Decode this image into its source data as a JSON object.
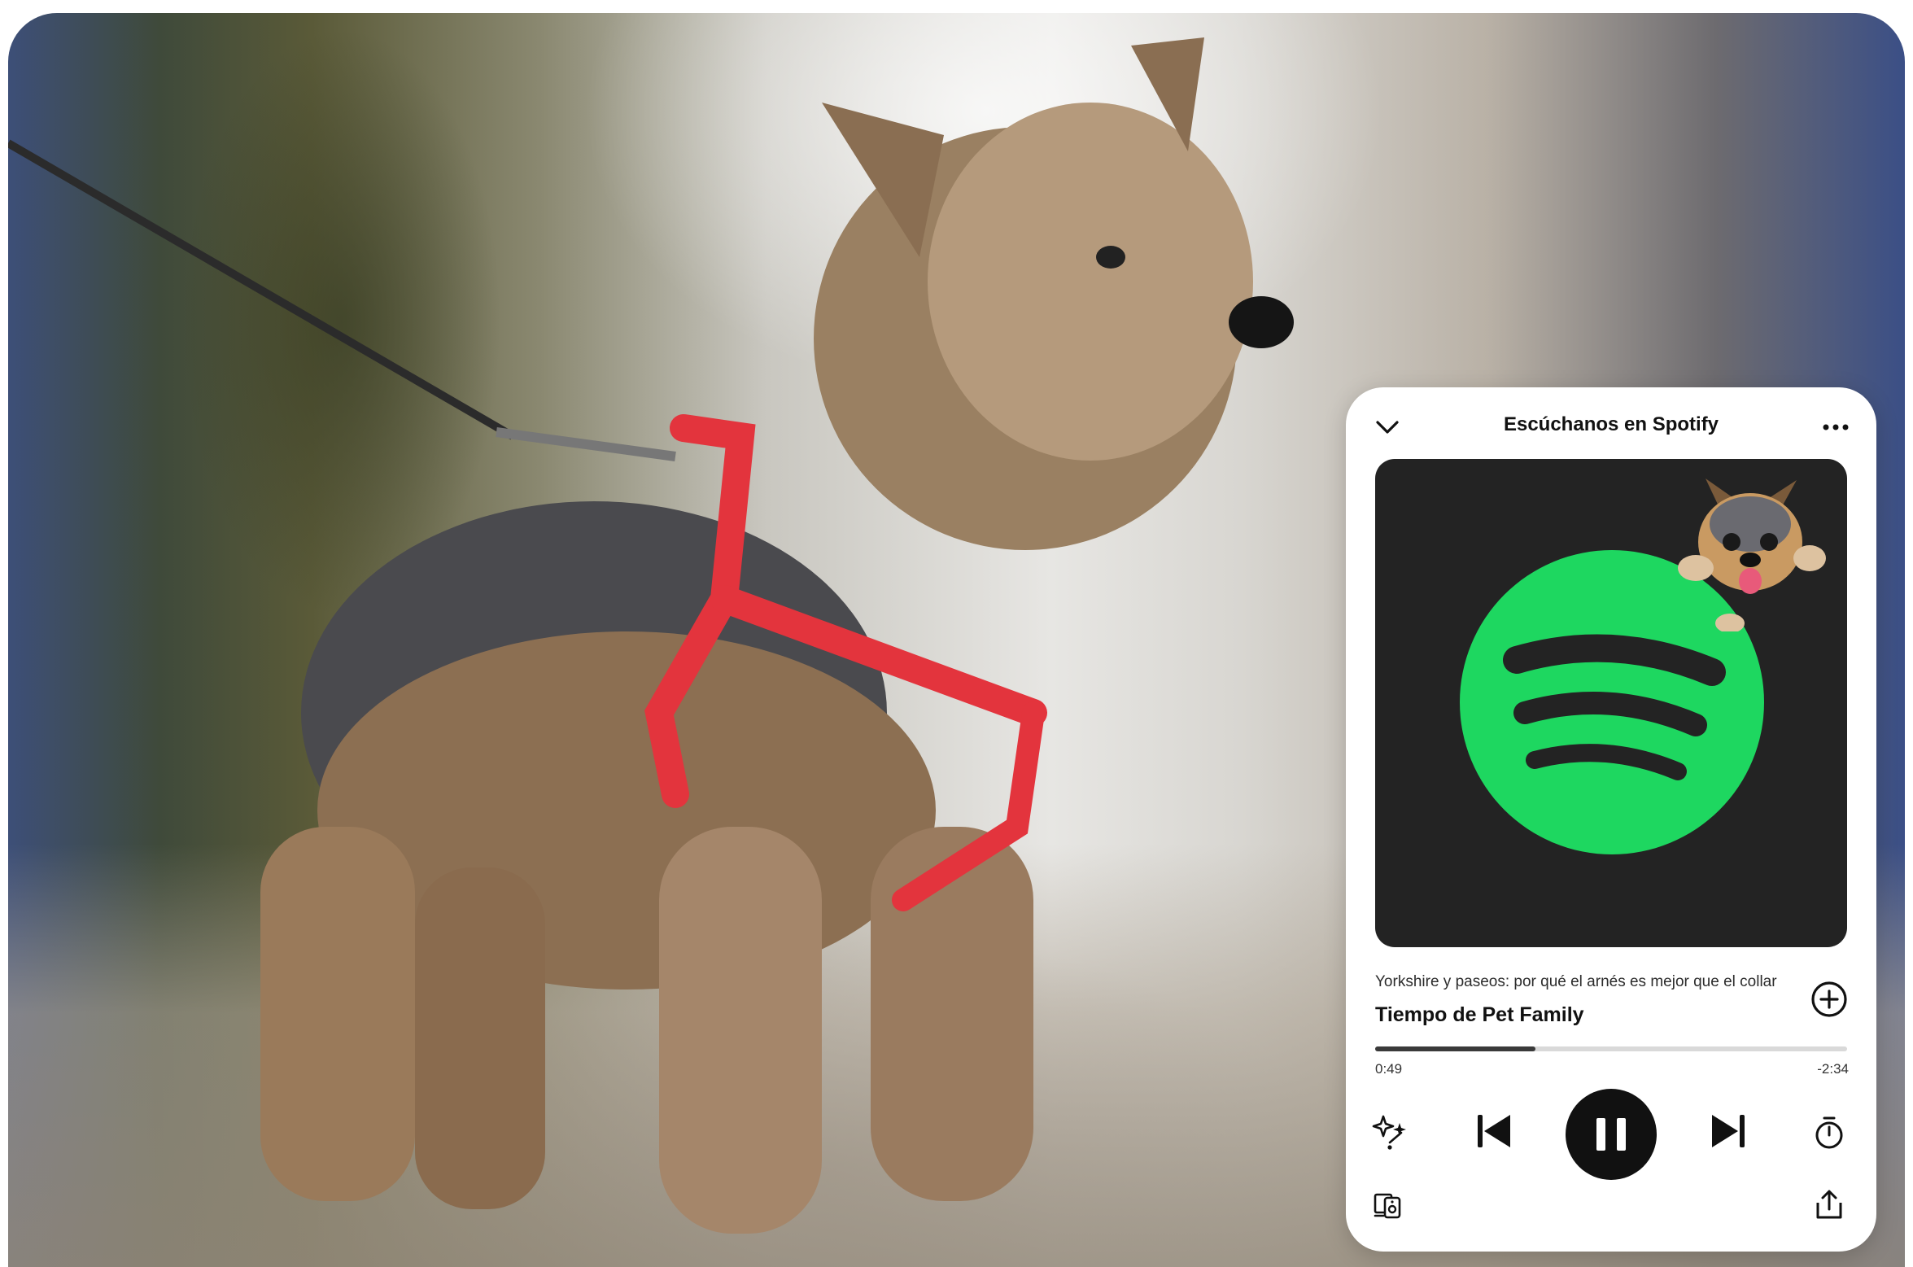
{
  "photo": {
    "description_icon": "yorkshire-dog-photo"
  },
  "player": {
    "header_title": "Escúchanos en Spotify",
    "icons": {
      "collapse": "chevron-down-icon",
      "more": "more-options-icon",
      "logo": "spotify-logo-icon",
      "add": "add-circle-icon",
      "enhance": "enhance-sparkle-icon",
      "previous": "skip-previous-icon",
      "pause": "pause-icon",
      "next": "skip-next-icon",
      "timer": "sleep-timer-icon",
      "devices": "connect-device-icon",
      "share": "share-icon"
    },
    "episode_title": "Yorkshire y paseos: por qué el arnés es mejor que el collar",
    "show_name": "Tiempo de Pet Family",
    "progress": 0.34,
    "time_elapsed": "0:49",
    "time_remaining": "-2:34",
    "state": "playing"
  },
  "colors": {
    "spotify_green": "#1ED760",
    "art_background": "#232323",
    "card_background": "#FFFFFF",
    "text_primary": "#111111"
  }
}
